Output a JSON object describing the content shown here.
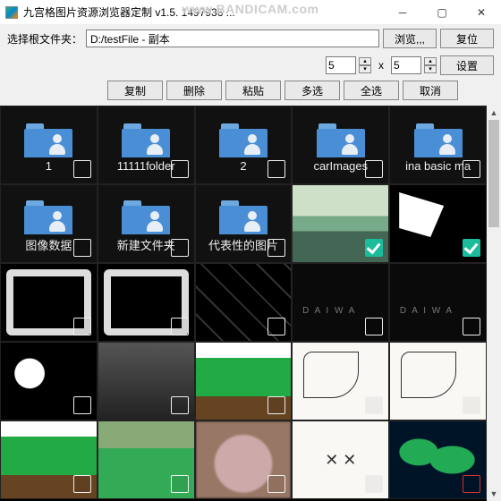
{
  "window": {
    "title": "九宫格图片资源浏览器定制 v1.5.          1497936 ...",
    "watermark": "www.BANDICAM.com"
  },
  "path_row": {
    "label": "选择根文件夹：",
    "path": "D:/testFile - 副本",
    "browse": "浏览,,,",
    "reset": "复位"
  },
  "size_row": {
    "cols": "5",
    "x": "x",
    "rows": "5",
    "settings": "设置"
  },
  "toolbar": {
    "copy": "复制",
    "delete": "删除",
    "paste": "粘贴",
    "multi": "多选",
    "all": "全选",
    "cancel": "取消"
  },
  "grid": {
    "folders": [
      {
        "label": "1"
      },
      {
        "label": "11111folder"
      },
      {
        "label": "2"
      },
      {
        "label": "carImages"
      },
      {
        "label": "ina basic ma"
      },
      {
        "label": "图像数据"
      },
      {
        "label": "新建文件夹"
      },
      {
        "label": "代表性的图片"
      }
    ]
  }
}
